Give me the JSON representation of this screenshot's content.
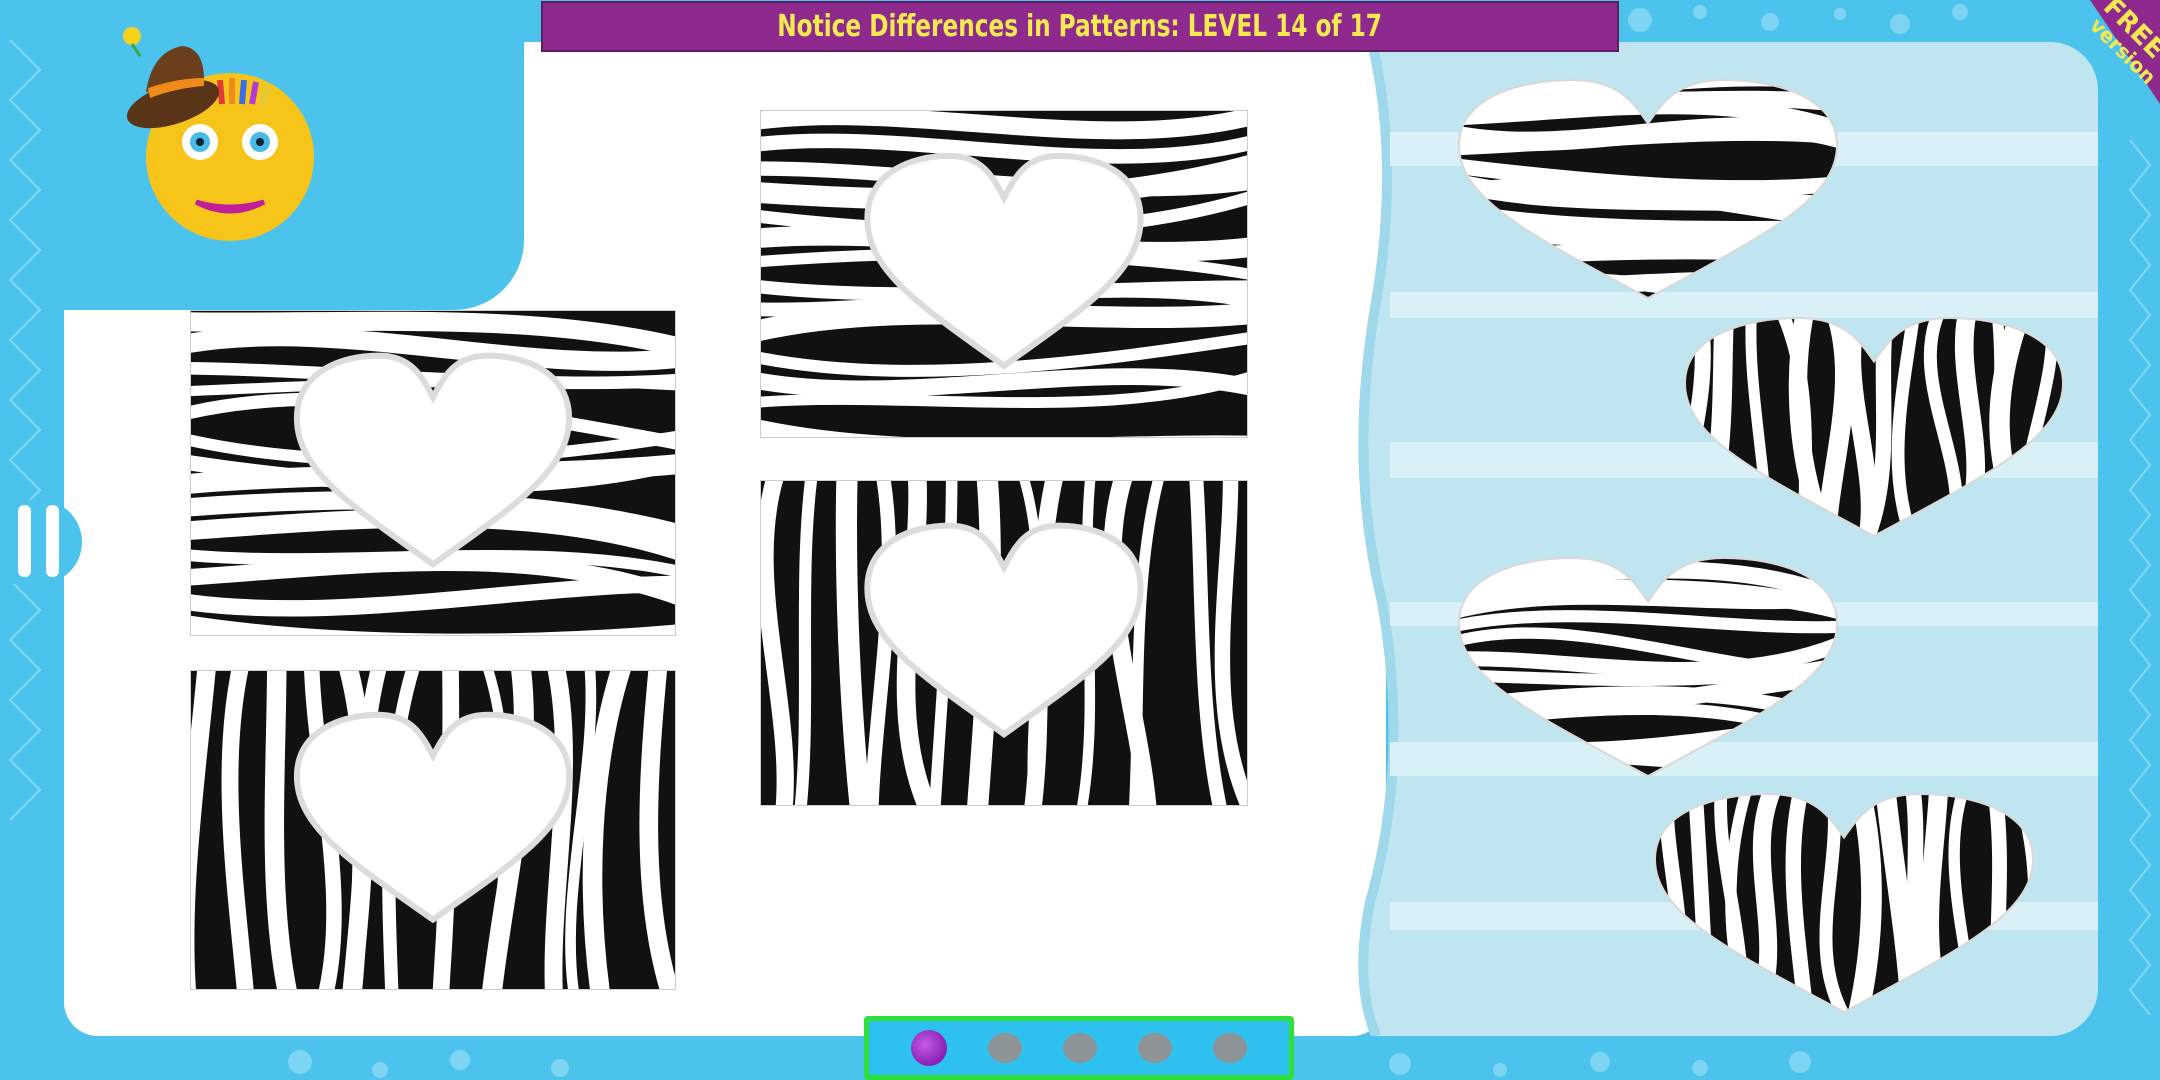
{
  "header": {
    "title": "Notice Differences in Patterns: LEVEL 14 of 17"
  },
  "badge": {
    "line1": "FREE",
    "line2": "version"
  },
  "colors": {
    "background": "#4cc3ec",
    "title_bar": "#8e2a8e",
    "title_text": "#f4ea4f",
    "side_panel": "#bfe6f0",
    "progress_border": "#2fe03a",
    "active_dot": "#9a2fcc",
    "inactive_dot": "#8c9497"
  },
  "icons": {
    "mascot": "smiley-face-with-hat",
    "pause": "pause-icon",
    "pattern": "zebra-stripes"
  },
  "puzzle": {
    "cards_with_heart_cutouts": 4,
    "heart_pieces": 4
  },
  "progress": {
    "total": 5,
    "current": 1
  }
}
